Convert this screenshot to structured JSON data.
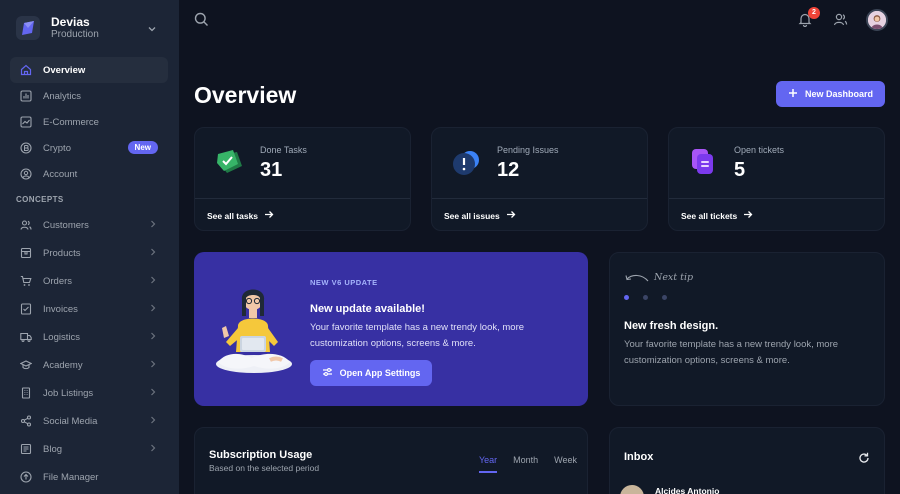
{
  "org": {
    "name": "Devias",
    "environment": "Production"
  },
  "nav": {
    "items": [
      {
        "label": "Overview",
        "icon": "home-icon",
        "active": true
      },
      {
        "label": "Analytics",
        "icon": "bar-chart-icon"
      },
      {
        "label": "E-Commerce",
        "icon": "line-chart-icon"
      },
      {
        "label": "Crypto",
        "icon": "currency-icon",
        "badge": "New"
      },
      {
        "label": "Account",
        "icon": "user-circle-icon"
      }
    ],
    "section_title": "CONCEPTS",
    "concepts": [
      {
        "label": "Customers",
        "icon": "users-icon"
      },
      {
        "label": "Products",
        "icon": "package-icon"
      },
      {
        "label": "Orders",
        "icon": "cart-icon"
      },
      {
        "label": "Invoices",
        "icon": "receipt-icon"
      },
      {
        "label": "Logistics",
        "icon": "truck-icon"
      },
      {
        "label": "Academy",
        "icon": "graduation-cap-icon"
      },
      {
        "label": "Job Listings",
        "icon": "building-icon"
      },
      {
        "label": "Social Media",
        "icon": "share-icon"
      },
      {
        "label": "Blog",
        "icon": "blog-icon"
      },
      {
        "label": "File Manager",
        "icon": "upload-icon"
      }
    ]
  },
  "topbar": {
    "notification_count": "2"
  },
  "header": {
    "title": "Overview",
    "new_dashboard_label": "New Dashboard"
  },
  "stats": [
    {
      "label": "Done Tasks",
      "value": "31",
      "link": "See all tasks",
      "icon": "check-shield-icon"
    },
    {
      "label": "Pending Issues",
      "value": "12",
      "link": "See all issues",
      "icon": "alert-bubble-icon"
    },
    {
      "label": "Open tickets",
      "value": "5",
      "link": "See all tickets",
      "icon": "tickets-icon"
    }
  ],
  "promo": {
    "eyebrow": "NEW V6 UPDATE",
    "headline": "New update available!",
    "body": "Your favorite template has a new trendy look, more customization options, screens & more.",
    "cta_label": "Open App Settings"
  },
  "tip": {
    "label": "Next tip",
    "title": "New fresh design.",
    "body": "Your favorite template has a new trendy look, more customization options, screens & more."
  },
  "subscription": {
    "title": "Subscription Usage",
    "subtitle": "Based on the selected period",
    "tabs": [
      "Year",
      "Month",
      "Week"
    ],
    "active_tab": "Year"
  },
  "inbox": {
    "title": "Inbox",
    "first_sender": "Alcides Antonio"
  },
  "colors": {
    "accent": "#6366f1",
    "sidebar": "#1c2536",
    "background": "#0e1320",
    "card": "#111927",
    "promo": "#3730a3"
  }
}
